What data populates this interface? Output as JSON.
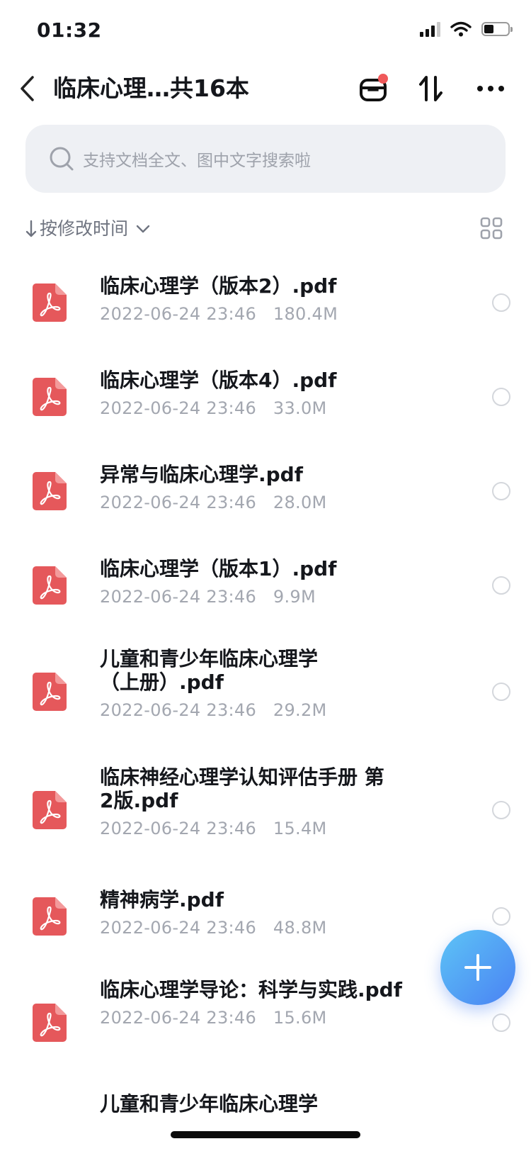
{
  "status_bar": {
    "time": "01:32",
    "battery_level": 0.42
  },
  "nav": {
    "title": "临床心理…共16本",
    "inbox_has_badge": true
  },
  "search": {
    "placeholder": "支持文档全文、图中文字搜索啦"
  },
  "sort": {
    "label": "按修改时间"
  },
  "files": [
    {
      "name": "临床心理学（版本2）.pdf",
      "date": "2022-06-24 23:46",
      "size": "180.4M"
    },
    {
      "name": "临床心理学（版本4）.pdf",
      "date": "2022-06-24 23:46",
      "size": "33.0M"
    },
    {
      "name": "异常与临床心理学.pdf",
      "date": "2022-06-24 23:46",
      "size": "28.0M"
    },
    {
      "name": "临床心理学（版本1）.pdf",
      "date": "2022-06-24 23:46",
      "size": "9.9M"
    },
    {
      "name": "儿童和青少年临床心理学（上册）.pdf",
      "date": "2022-06-24 23:46",
      "size": "29.2M"
    },
    {
      "name": "临床神经心理学认知评估手册 第2版.pdf",
      "date": "2022-06-24 23:46",
      "size": "15.4M"
    },
    {
      "name": "精神病学.pdf",
      "date": "2022-06-24 23:46",
      "size": "48.8M"
    },
    {
      "name": "临床心理学导论：科学与实践.pdf",
      "date": "2022-06-24 23:46",
      "size": "15.6M"
    },
    {
      "name": "儿童和青少年临床心理学",
      "date": "",
      "size": ""
    }
  ],
  "icons": {
    "file": "pdf-icon",
    "search": "search-icon",
    "back": "chevron-left-icon",
    "inbox": "inbox-icon",
    "sort": "sort-arrows-icon",
    "more": "more-icon",
    "grid": "grid-view-icon",
    "add": "plus-icon"
  },
  "colors": {
    "accent": "#4a82f3",
    "pdf": "#e5585b",
    "badge": "#f0595a"
  }
}
